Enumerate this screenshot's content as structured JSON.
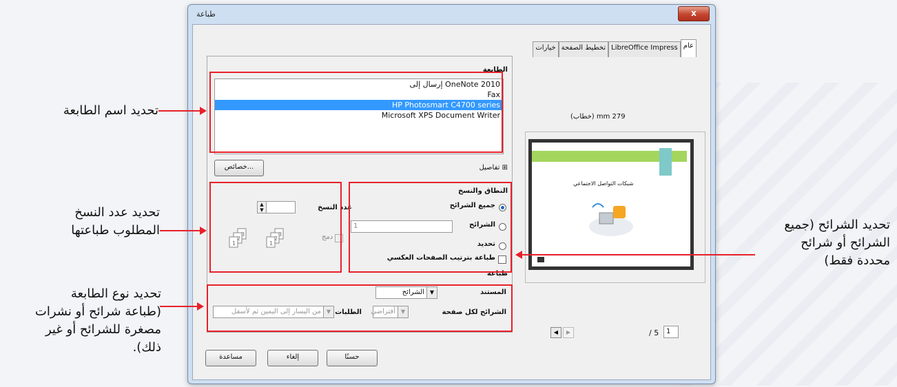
{
  "dialog": {
    "title": "طباعة",
    "close_label": "x",
    "tabs": [
      "عام",
      "LibreOffice Impress",
      "تخطيط الصفحة",
      "خيارات"
    ]
  },
  "printer": {
    "section_label": "الطابعة",
    "items": [
      "إرسال إلى OneNote 2010",
      "Fax",
      "HP Photosmart C4700 series",
      "Microsoft XPS Document Writer"
    ],
    "selected_index": 2,
    "details_label": "تفاصيل",
    "properties_button": "خصائص..."
  },
  "range": {
    "section_label": "النطاق والنسخ",
    "all_slides": "جميع الشرائح",
    "slides": "الشرائح",
    "slides_value": "1",
    "selection": "تحديد",
    "reverse_label": "طباعة بترتيب الصفحات العكسي"
  },
  "copies": {
    "label": "عدد النسخ",
    "value": "1",
    "collate_label": "دمج"
  },
  "print": {
    "section_label": "طباعة",
    "document_label": "المستند",
    "document_value": "الشرائح",
    "slides_per_page_label": "الشرائح لكل صفحة",
    "slides_per_page_value": "أفتراضي",
    "order_label": "الطلبات",
    "order_value": "من اليسار إلى اليمين ثم لأسفل"
  },
  "preview": {
    "size_label": "279 mm (خطاب)",
    "slide_title": "شبكات التواصل الاجتماعي",
    "page_current": "1",
    "page_total": "/ 5"
  },
  "buttons": {
    "ok": "حسنًا",
    "cancel": "إلغاء",
    "help": "مساعدة"
  },
  "callouts": {
    "printer_name": "تحديد اسم الطابعة",
    "copies_line1": "تحديد عدد النسخ",
    "copies_line2": "المطلوب طباعتها",
    "type_line1": "تحديد نوع الطابعة",
    "type_line2": "(طباعة شرائح أو نشرات",
    "type_line3": "مصغرة للشرائح أو غير",
    "type_line4": "ذلك).",
    "slides_line1": "تحديد الشرائح (جميع",
    "slides_line2": "الشرائح أو شرائح",
    "slides_line3": "محددة فقط)"
  },
  "colors": {
    "accent_red": "#e8202a",
    "selection_blue": "#3399ff",
    "slide_green": "#a4d65e",
    "slide_teal": "#7fc9c9"
  }
}
